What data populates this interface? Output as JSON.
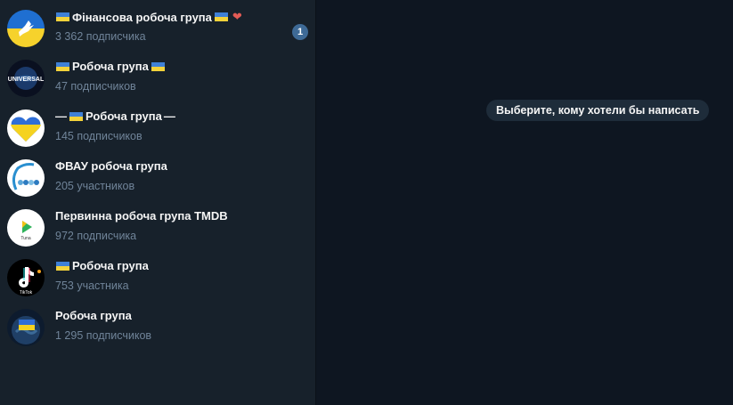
{
  "chats": [
    {
      "title_prefix": "",
      "title": "Фінансова робоча група",
      "title_suffix": "",
      "has_flag_before": true,
      "has_flag_after": true,
      "has_heart": true,
      "subtitle": "3 362 подписчика",
      "unread": "1",
      "avatar": "dove-on-ukraine-flag"
    },
    {
      "title_prefix": "",
      "title": "Робоча група",
      "title_suffix": "",
      "has_flag_before": true,
      "has_flag_after": true,
      "has_heart": false,
      "subtitle": "47 подписчиков",
      "unread": "",
      "avatar": "universal-globe-logo"
    },
    {
      "title_prefix": "—",
      "title": "Робоча група",
      "title_suffix": "—",
      "has_flag_before": true,
      "has_flag_after": false,
      "has_heart": false,
      "subtitle": "145 подписчиков",
      "unread": "",
      "avatar": "ukraine-heart"
    },
    {
      "title_prefix": "",
      "title": "ФВАУ робоча група",
      "title_suffix": "",
      "has_flag_before": false,
      "has_flag_after": false,
      "has_heart": false,
      "subtitle": "205 участников",
      "unread": "",
      "avatar": "fvau-logo"
    },
    {
      "title_prefix": "",
      "title": "Первинна робоча група TMDB",
      "title_suffix": "",
      "has_flag_before": false,
      "has_flag_after": false,
      "has_heart": false,
      "subtitle": "972 подписчика",
      "unread": "",
      "avatar": "play-logo"
    },
    {
      "title_prefix": "",
      "title": "Робоча група",
      "title_suffix": "",
      "has_flag_before": true,
      "has_flag_after": false,
      "has_heart": false,
      "subtitle": "753 участника",
      "unread": "",
      "avatar": "tiktok-logo"
    },
    {
      "title_prefix": "",
      "title": "Робоча група",
      "title_suffix": "",
      "has_flag_before": false,
      "has_flag_after": false,
      "has_heart": false,
      "subtitle": "1 295 подписчиков",
      "unread": "",
      "avatar": "earth-with-flag"
    }
  ],
  "avatar_texts": {
    "universal": "UNIVERSAL",
    "play": "Tuna",
    "tiktok": "TikTok"
  },
  "main": {
    "empty_message": "Выберите, кому хотели бы написать"
  },
  "colors": {
    "sidebar_bg": "#17212b",
    "main_bg": "#0e1621",
    "badge_bg": "#3e6a96",
    "subtitle": "#708499"
  }
}
